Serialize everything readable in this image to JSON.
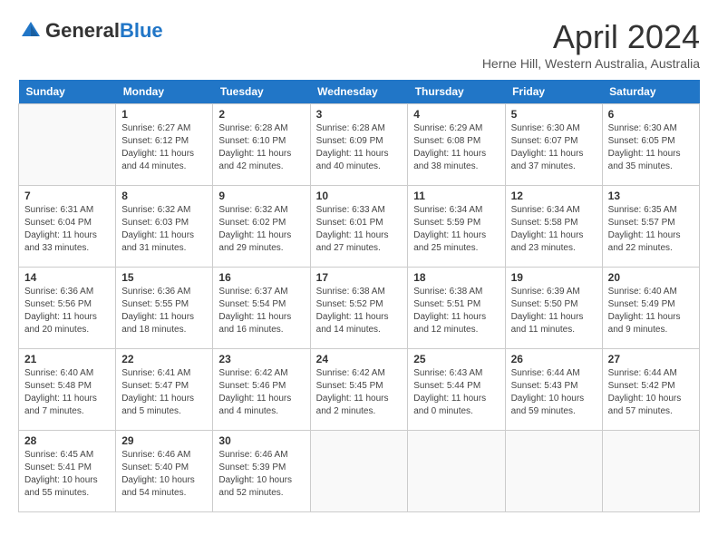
{
  "header": {
    "logo_general": "General",
    "logo_blue": "Blue",
    "month_title": "April 2024",
    "subtitle": "Herne Hill, Western Australia, Australia"
  },
  "weekdays": [
    "Sunday",
    "Monday",
    "Tuesday",
    "Wednesday",
    "Thursday",
    "Friday",
    "Saturday"
  ],
  "weeks": [
    [
      {
        "day": "",
        "info": ""
      },
      {
        "day": "1",
        "info": "Sunrise: 6:27 AM\nSunset: 6:12 PM\nDaylight: 11 hours\nand 44 minutes."
      },
      {
        "day": "2",
        "info": "Sunrise: 6:28 AM\nSunset: 6:10 PM\nDaylight: 11 hours\nand 42 minutes."
      },
      {
        "day": "3",
        "info": "Sunrise: 6:28 AM\nSunset: 6:09 PM\nDaylight: 11 hours\nand 40 minutes."
      },
      {
        "day": "4",
        "info": "Sunrise: 6:29 AM\nSunset: 6:08 PM\nDaylight: 11 hours\nand 38 minutes."
      },
      {
        "day": "5",
        "info": "Sunrise: 6:30 AM\nSunset: 6:07 PM\nDaylight: 11 hours\nand 37 minutes."
      },
      {
        "day": "6",
        "info": "Sunrise: 6:30 AM\nSunset: 6:05 PM\nDaylight: 11 hours\nand 35 minutes."
      }
    ],
    [
      {
        "day": "7",
        "info": "Sunrise: 6:31 AM\nSunset: 6:04 PM\nDaylight: 11 hours\nand 33 minutes."
      },
      {
        "day": "8",
        "info": "Sunrise: 6:32 AM\nSunset: 6:03 PM\nDaylight: 11 hours\nand 31 minutes."
      },
      {
        "day": "9",
        "info": "Sunrise: 6:32 AM\nSunset: 6:02 PM\nDaylight: 11 hours\nand 29 minutes."
      },
      {
        "day": "10",
        "info": "Sunrise: 6:33 AM\nSunset: 6:01 PM\nDaylight: 11 hours\nand 27 minutes."
      },
      {
        "day": "11",
        "info": "Sunrise: 6:34 AM\nSunset: 5:59 PM\nDaylight: 11 hours\nand 25 minutes."
      },
      {
        "day": "12",
        "info": "Sunrise: 6:34 AM\nSunset: 5:58 PM\nDaylight: 11 hours\nand 23 minutes."
      },
      {
        "day": "13",
        "info": "Sunrise: 6:35 AM\nSunset: 5:57 PM\nDaylight: 11 hours\nand 22 minutes."
      }
    ],
    [
      {
        "day": "14",
        "info": "Sunrise: 6:36 AM\nSunset: 5:56 PM\nDaylight: 11 hours\nand 20 minutes."
      },
      {
        "day": "15",
        "info": "Sunrise: 6:36 AM\nSunset: 5:55 PM\nDaylight: 11 hours\nand 18 minutes."
      },
      {
        "day": "16",
        "info": "Sunrise: 6:37 AM\nSunset: 5:54 PM\nDaylight: 11 hours\nand 16 minutes."
      },
      {
        "day": "17",
        "info": "Sunrise: 6:38 AM\nSunset: 5:52 PM\nDaylight: 11 hours\nand 14 minutes."
      },
      {
        "day": "18",
        "info": "Sunrise: 6:38 AM\nSunset: 5:51 PM\nDaylight: 11 hours\nand 12 minutes."
      },
      {
        "day": "19",
        "info": "Sunrise: 6:39 AM\nSunset: 5:50 PM\nDaylight: 11 hours\nand 11 minutes."
      },
      {
        "day": "20",
        "info": "Sunrise: 6:40 AM\nSunset: 5:49 PM\nDaylight: 11 hours\nand 9 minutes."
      }
    ],
    [
      {
        "day": "21",
        "info": "Sunrise: 6:40 AM\nSunset: 5:48 PM\nDaylight: 11 hours\nand 7 minutes."
      },
      {
        "day": "22",
        "info": "Sunrise: 6:41 AM\nSunset: 5:47 PM\nDaylight: 11 hours\nand 5 minutes."
      },
      {
        "day": "23",
        "info": "Sunrise: 6:42 AM\nSunset: 5:46 PM\nDaylight: 11 hours\nand 4 minutes."
      },
      {
        "day": "24",
        "info": "Sunrise: 6:42 AM\nSunset: 5:45 PM\nDaylight: 11 hours\nand 2 minutes."
      },
      {
        "day": "25",
        "info": "Sunrise: 6:43 AM\nSunset: 5:44 PM\nDaylight: 11 hours\nand 0 minutes."
      },
      {
        "day": "26",
        "info": "Sunrise: 6:44 AM\nSunset: 5:43 PM\nDaylight: 10 hours\nand 59 minutes."
      },
      {
        "day": "27",
        "info": "Sunrise: 6:44 AM\nSunset: 5:42 PM\nDaylight: 10 hours\nand 57 minutes."
      }
    ],
    [
      {
        "day": "28",
        "info": "Sunrise: 6:45 AM\nSunset: 5:41 PM\nDaylight: 10 hours\nand 55 minutes."
      },
      {
        "day": "29",
        "info": "Sunrise: 6:46 AM\nSunset: 5:40 PM\nDaylight: 10 hours\nand 54 minutes."
      },
      {
        "day": "30",
        "info": "Sunrise: 6:46 AM\nSunset: 5:39 PM\nDaylight: 10 hours\nand 52 minutes."
      },
      {
        "day": "",
        "info": ""
      },
      {
        "day": "",
        "info": ""
      },
      {
        "day": "",
        "info": ""
      },
      {
        "day": "",
        "info": ""
      }
    ]
  ]
}
